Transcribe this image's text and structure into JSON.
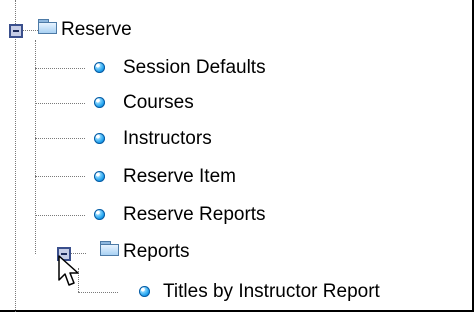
{
  "tree": {
    "root": {
      "label": "Reserve",
      "expanded": true,
      "children": [
        {
          "label": "Session Defaults",
          "icon": "blue-bullet-icon"
        },
        {
          "label": "Courses",
          "icon": "blue-bullet-icon"
        },
        {
          "label": "Instructors",
          "icon": "blue-bullet-icon"
        },
        {
          "label": "Reserve Item",
          "icon": "blue-bullet-icon"
        },
        {
          "label": "Reserve Reports",
          "icon": "blue-bullet-icon"
        },
        {
          "label": "Reports",
          "icon": "folder-icon",
          "expanded": true,
          "children": [
            {
              "label": "Titles by Instructor Report",
              "icon": "blue-bullet-icon"
            }
          ]
        }
      ]
    }
  }
}
